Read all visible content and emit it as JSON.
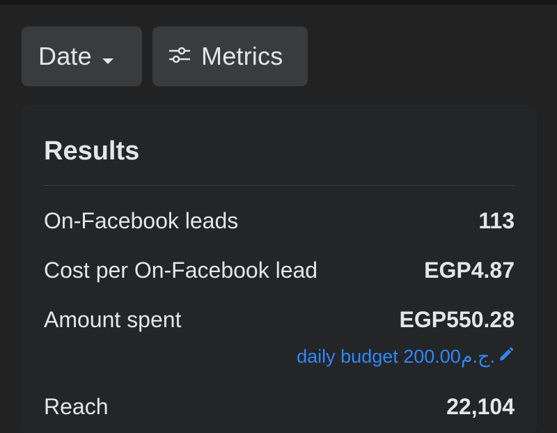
{
  "filters": {
    "date_label": "Date",
    "metrics_label": "Metrics"
  },
  "results": {
    "title": "Results",
    "rows": [
      {
        "label": "On-Facebook leads",
        "value": "113"
      },
      {
        "label": "Cost per On-Facebook lead",
        "value": "EGP4.87"
      },
      {
        "label": "Amount spent",
        "value": "EGP550.28"
      },
      {
        "label": "Reach",
        "value": "22,104"
      }
    ],
    "budget_text": "daily budget 200.00ج.م."
  },
  "icons": {
    "date_caret": "caret-down-icon",
    "metrics": "sliders-icon",
    "budget_edit": "pencil-icon"
  },
  "colors": {
    "background": "#222223",
    "chip": "#3a3b3c",
    "link": "#2d88ff",
    "text": "#e4e6eb"
  }
}
